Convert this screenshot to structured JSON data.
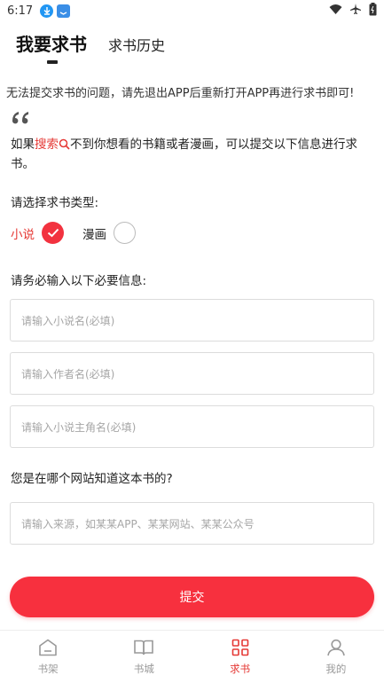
{
  "status_bar": {
    "time": "6:17",
    "icons": [
      "download-icon",
      "app-notification-icon",
      "wifi-icon",
      "airplane-mode-icon",
      "battery-icon"
    ]
  },
  "top_tabs": {
    "active": "我要求书",
    "history": "求书历史"
  },
  "notice": "无法提交求书的问题，请先退出APP后重新打开APP再进行求书即可!",
  "intro": {
    "prefix": "如果",
    "search_word": "搜索",
    "suffix": "不到你想看的书籍或者漫画，可以提交以下信息进行求书。"
  },
  "type_section": {
    "label": "请选择求书类型:",
    "options": [
      {
        "label": "小说",
        "selected": true
      },
      {
        "label": "漫画",
        "selected": false
      }
    ]
  },
  "required_section": {
    "label": "请务必输入以下必要信息:",
    "fields": [
      {
        "placeholder": "请输入小说名(必填)"
      },
      {
        "placeholder": "请输入作者名(必填)"
      },
      {
        "placeholder": "请输入小说主角名(必填)"
      }
    ]
  },
  "source_section": {
    "label": "您是在哪个网站知道这本书的?",
    "placeholder": "请输入来源，如某某APP、某某网站、某某公众号"
  },
  "submit_label": "提交",
  "bottom_nav": [
    {
      "label": "书架",
      "icon": "bookshelf-icon",
      "active": false
    },
    {
      "label": "书城",
      "icon": "bookstore-icon",
      "active": false
    },
    {
      "label": "求书",
      "icon": "request-book-icon",
      "active": true
    },
    {
      "label": "我的",
      "icon": "profile-icon",
      "active": false
    }
  ],
  "colors": {
    "accent": "#f7303e",
    "text": "#222222",
    "placeholder": "#a6a6a6",
    "inactive_nav": "#999999"
  }
}
